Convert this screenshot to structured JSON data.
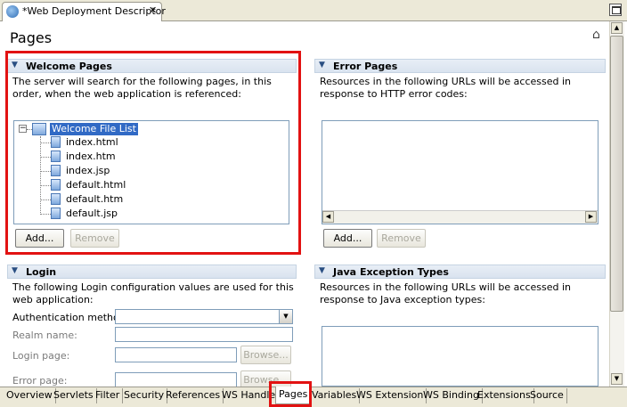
{
  "editor_tab": {
    "title": "*Web Deployment Descriptor",
    "close": "✕"
  },
  "page_title": "Pages",
  "welcome": {
    "title": "Welcome Pages",
    "description": "The server will search for the following pages, in this order, when the web application is referenced:",
    "root": "Welcome File List",
    "files": [
      "index.html",
      "index.htm",
      "index.jsp",
      "default.html",
      "default.htm",
      "default.jsp"
    ],
    "add": "Add...",
    "remove": "Remove"
  },
  "error": {
    "title": "Error Pages",
    "description": "Resources in the following URLs will be accessed in response to HTTP error codes:",
    "add": "Add...",
    "remove": "Remove"
  },
  "login": {
    "title": "Login",
    "description": "The following Login configuration values are used for this web application:",
    "auth_label": "Authentication method:",
    "realm_label": "Realm name:",
    "login_page_label": "Login page:",
    "error_page_label": "Error page:",
    "browse": "Browse..."
  },
  "java_exc": {
    "title": "Java Exception Types",
    "description": "Resources in the following URLs will be accessed in response to Java exception types:"
  },
  "bottom_tabs": [
    "Overview",
    "Servlets",
    "Filter",
    "Security",
    "References",
    "WS Handler",
    "Pages",
    "Variables",
    "WS Extension",
    "WS Binding",
    "Extensions",
    "Source"
  ],
  "selected_tab": "Pages",
  "colors": {
    "highlight": "#e21212",
    "selection": "#316ac5"
  }
}
